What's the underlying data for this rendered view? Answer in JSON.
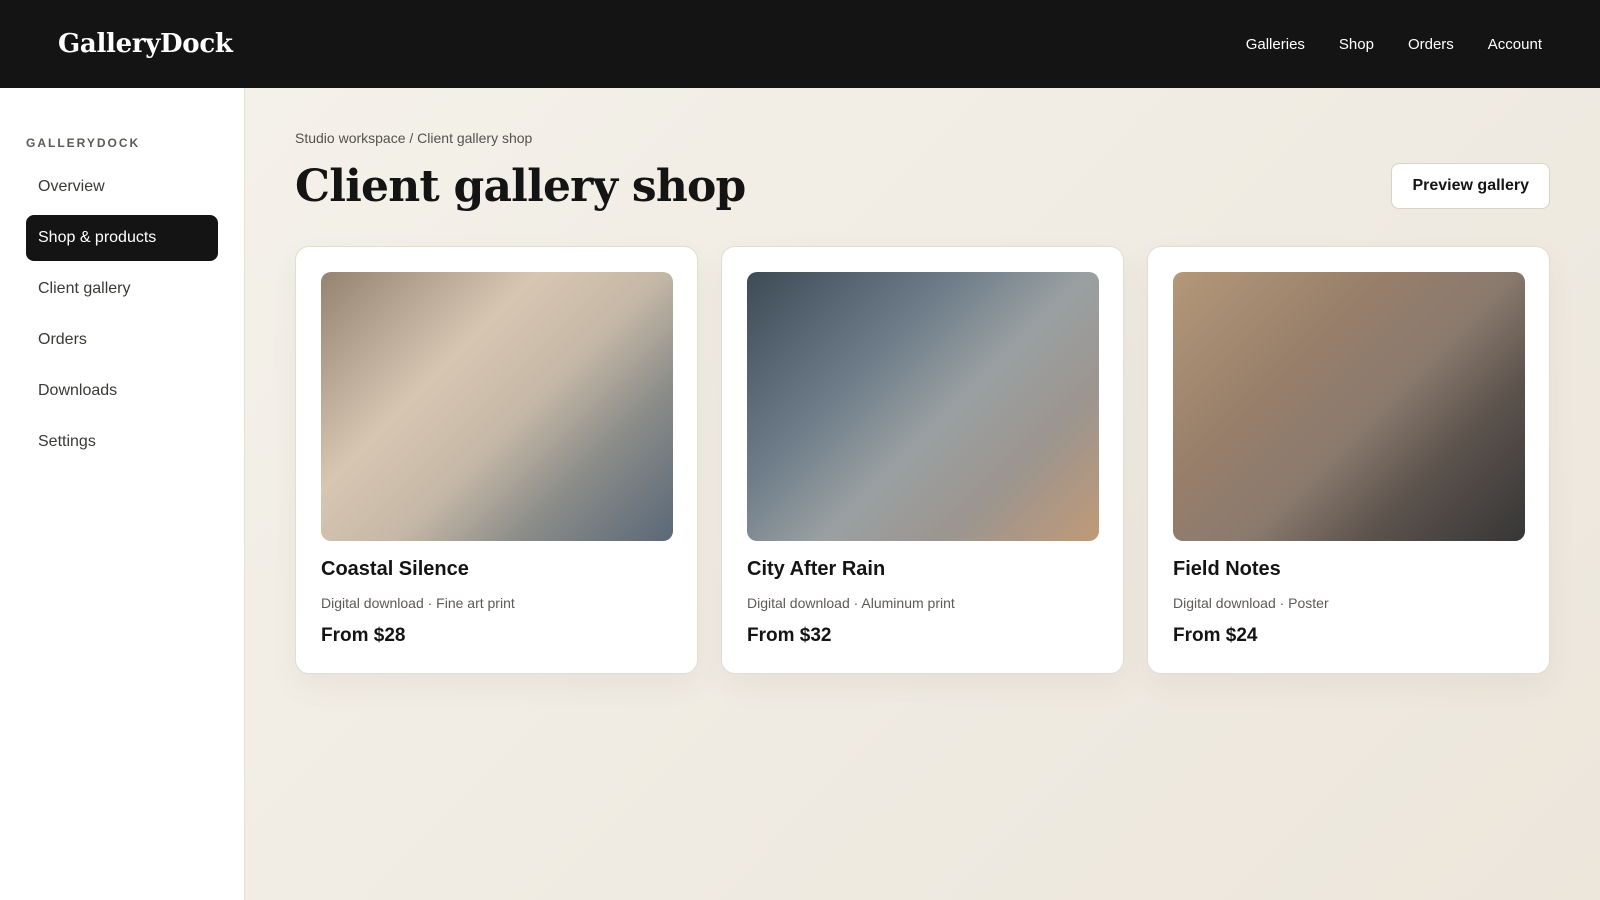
{
  "header": {
    "logo": "GalleryDock",
    "nav": [
      "Galleries",
      "Shop",
      "Orders",
      "Account"
    ]
  },
  "sidebar": {
    "heading": "GALLERYDOCK",
    "items": [
      {
        "label": "Overview",
        "active": false
      },
      {
        "label": "Shop & products",
        "active": true
      },
      {
        "label": "Client gallery",
        "active": false
      },
      {
        "label": "Orders",
        "active": false
      },
      {
        "label": "Downloads",
        "active": false
      },
      {
        "label": "Settings",
        "active": false
      }
    ]
  },
  "main": {
    "breadcrumb": "Studio workspace / Client gallery shop",
    "title": "Client gallery shop",
    "preview_button": "Preview gallery",
    "products": [
      {
        "title": "Coastal Silence",
        "meta": "Digital download · Fine art print",
        "price": "From $28"
      },
      {
        "title": "City After Rain",
        "meta": "Digital download · Aluminum print",
        "price": "From $32"
      },
      {
        "title": "Field Notes",
        "meta": "Digital download · Poster",
        "price": "From $24"
      }
    ]
  },
  "colors": {
    "topbar": "#141414",
    "active_nav": "#141414",
    "page_background": "#f4f1ea"
  }
}
